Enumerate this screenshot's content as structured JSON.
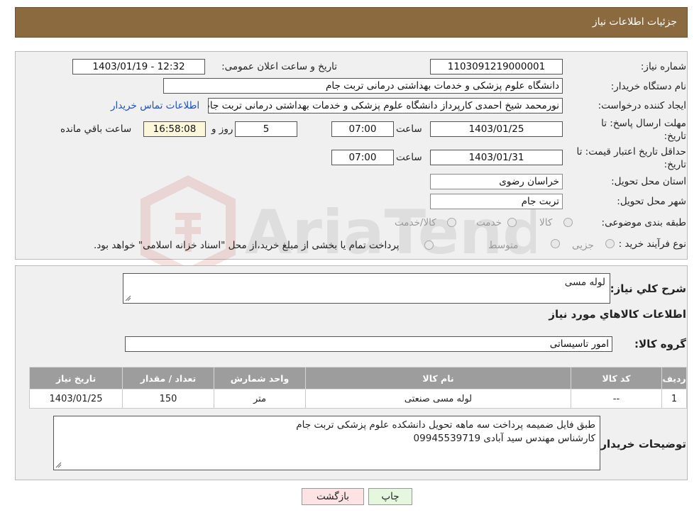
{
  "header": {
    "title": "جزئیات اطلاعات نیاز"
  },
  "details": {
    "need_number_label": "شماره نیاز:",
    "need_number": "1103091219000001",
    "announce_label": "تاریخ و ساعت اعلان عمومی:",
    "announce_value": "1403/01/19 - 12:32",
    "buyer_org_label": "نام دستگاه خریدار:",
    "buyer_org": "دانشگاه علوم پزشکی و خدمات بهداشتی  درمانی تربت جام",
    "requester_label": "ایجاد کننده درخواست:",
    "requester": "نورمحمد شیخ احمدی کارپرداز دانشگاه علوم پزشکی و خدمات بهداشتی  درمانی تربت جام",
    "contact_link": "اطلاعات تماس خریدار",
    "deadline_label_1": "مهلت ارسال پاسخ: تا",
    "deadline_label_2": "تاریخ:",
    "deadline_date": "1403/01/25",
    "time_label": "ساعت",
    "deadline_time": "07:00",
    "days_value": "5",
    "days_label": "روز و",
    "remaining_time": "16:58:08",
    "remaining_label": "ساعت باقي مانده",
    "validity_label_1": "حداقل تاریخ اعتبار قیمت: تا",
    "validity_label_2": "تاریخ:",
    "validity_date": "1403/01/31",
    "validity_time": "07:00",
    "province_label": "استان محل تحویل:",
    "province": "خراسان رضوی",
    "city_label": "شهر محل تحویل:",
    "city": "تربت جام",
    "category_label": "طبقه بندی موضوعی:",
    "category_options": [
      "کالا",
      "خدمت",
      "کالا/خدمت"
    ],
    "process_label": "نوع فرآیند خرید :",
    "process_options": [
      "جزیی",
      "متوسط"
    ],
    "process_note": "پرداخت تمام یا بخشی از مبلغ خرید،از محل \"اسناد خزانه اسلامی\" خواهد بود."
  },
  "watermark": {
    "text": "AriaTender.neT"
  },
  "need": {
    "summary_label": "شرح کلي نياز:",
    "summary": "لوله مسی",
    "goods_info_title": "اطلاعات کالاهاي مورد نياز",
    "group_label": "گروه کالا:",
    "group": "امور تاسیساتی"
  },
  "table": {
    "columns": [
      "رديف",
      "کد کالا",
      "نام کالا",
      "واحد شمارش",
      "تعداد / مقدار",
      "تاریخ نیاز"
    ],
    "rows": [
      [
        "1",
        "--",
        "لوله مسی صنعتی",
        "متر",
        "150",
        "1403/01/25"
      ]
    ]
  },
  "buyer_notes": {
    "label": "توضیحات خریدار:",
    "line1": "طبق فایل ضمیمه پرداخت سه ماهه تحویل دانشکده علوم پزشکی تربت جام",
    "line2": "کارشناس مهندس سید آبادی 09945539719"
  },
  "buttons": {
    "print": "چاپ",
    "back": "بازگشت"
  },
  "colors": {
    "header_bg": "#8c6a40",
    "table_header_bg": "#9d9d9d",
    "link": "#1f4ec2",
    "back_btn_bg": "#fde3e3",
    "print_btn_bg": "#e6f7e0"
  }
}
